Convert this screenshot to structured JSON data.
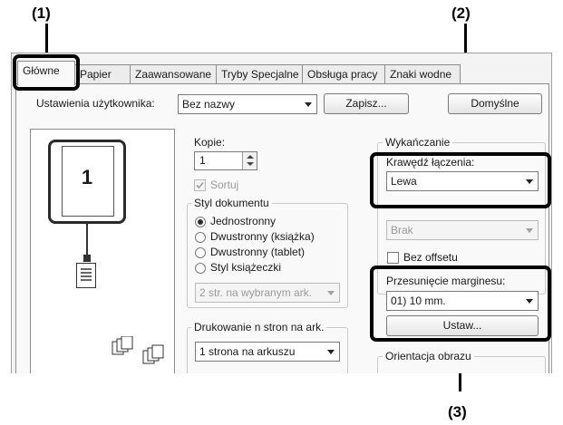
{
  "callouts": {
    "c1": "(1)",
    "c2": "(2)",
    "c3": "(3)"
  },
  "tabs": [
    "Główne",
    "Papier",
    "Zaawansowane",
    "Tryby Specjalne",
    "Obsługa pracy",
    "Znaki wodne"
  ],
  "user_settings": {
    "label": "Ustawienia użytkownika:",
    "value": "Bez nazwy",
    "save_label": "Zapisz...",
    "defaults_label": "Domyślne"
  },
  "preview": {
    "page_number": "1"
  },
  "copies": {
    "label": "Kopie:",
    "value": "1"
  },
  "sort": {
    "label": "Sortuj",
    "checked": true,
    "enabled": false
  },
  "document_style": {
    "legend": "Styl dokumentu",
    "options": [
      "Jednostronny",
      "Dwustronny (książka)",
      "Dwustronny (tablet)",
      "Styl książeczki"
    ],
    "selected": "Jednostronny",
    "booklet_combo": "2 str. na wybranym ark."
  },
  "n_up": {
    "legend": "Drukowanie n stron na ark.",
    "value": "1 strona na arkuszu"
  },
  "finishing": {
    "legend": "Wykańczanie",
    "binding_edge_label": "Krawędź łączenia:",
    "binding_edge_value": "Lewa",
    "staple_value": "Brak",
    "no_offset_label": "Bez offsetu",
    "no_offset_checked": false
  },
  "margin_shift": {
    "label": "Przesunięcie marginesu:",
    "value": "01) 10 mm.",
    "set_label": "Ustaw..."
  },
  "orientation": {
    "legend": "Orientacja obrazu"
  },
  "icons": {
    "arrow": "chevron-down-icon",
    "spin": "spin-arrows-icon",
    "document": "document-icon",
    "copies": "multi-copy-icon",
    "printer": "printer-icon"
  },
  "colors": {
    "highlight": "#000000",
    "dialog_bg": "#f3f3f3",
    "panel_bg": "#f9f9f9"
  }
}
